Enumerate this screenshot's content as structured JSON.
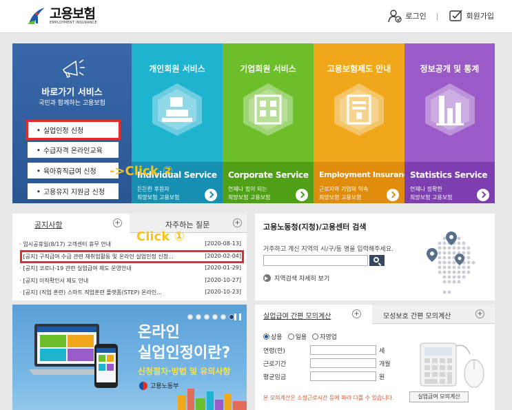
{
  "header": {
    "logo_title": "고용보험",
    "logo_sub": "EMPLOYMENT INSURANCE",
    "login": "로그인",
    "separator": "|",
    "join": "회원가입"
  },
  "shortcut": {
    "title": "바로가기 서비스",
    "subtitle": "국민과 함께하는 고용보험",
    "items": [
      {
        "label": "실업인정 신청"
      },
      {
        "label": "수급자격 온라인교육"
      },
      {
        "label": "육아휴직급여 신청"
      },
      {
        "label": "고용유지 지원금 신청"
      }
    ]
  },
  "annotations": {
    "click2": "->Click ②",
    "click1": "Click ①"
  },
  "panels": [
    {
      "title": "개인회원 서비스",
      "en": "Individual Service",
      "d1": "든든한 후원자",
      "d2": "희망보험 고용보험",
      "color": "#1eb3cf",
      "bottom": "#168fb2"
    },
    {
      "title": "기업회원 서비스",
      "en": "Corporate Service",
      "d1": "언제나 힘이 되는",
      "d2": "희망보험 고용보험",
      "color": "#6cbf2a",
      "bottom": "#4f9f17"
    },
    {
      "title": "고용보험제도 안내",
      "en": "Employment Insurance",
      "d1": "근로자와 기업의 약속",
      "d2": "희망보험 고용보험",
      "color": "#f0a81a",
      "bottom": "#e08d0e"
    },
    {
      "title": "정보공개 및 통계",
      "en": "Statistics Service",
      "d1": "언제나 정확한",
      "d2": "희망보험 고용보험",
      "color": "#9a5ac8",
      "bottom": "#7d3fb0"
    }
  ],
  "notice": {
    "tab_notice": "공지사항",
    "tab_faq": "자주하는 질문",
    "plus": "+",
    "items": [
      {
        "title": "임시공휴일(8/17) 고객센터 휴무 안내",
        "date": "[2020-08-13]"
      },
      {
        "title": "[공지] 구직급여 수급 관련 재취업활동 및 온라인 실업인정 신청...",
        "date": "[2020-02-04]"
      },
      {
        "title": "[공지] 코로나-19 관련 실업급여 제도 운영안내",
        "date": "[2020-01-29]"
      },
      {
        "title": "[공지] 이직확인서 제도 안내",
        "date": "[2020-10-27]"
      },
      {
        "title": "[공지] (직업 훈련) 스마트 직업훈련 플랫폼(STEP) 온라인...",
        "date": "[2020-10-23]"
      }
    ]
  },
  "search": {
    "title": "고용노동청(지청)/고용센터 검색",
    "desc": "거주하고 계신 지역의 시/구/동 명을 입력해주세요.",
    "input_value": "",
    "detail": "지역검색 자세히 보기"
  },
  "banner": {
    "line1": "온라인",
    "line2": "실업인정이란?",
    "line3": "신청절차·방법 및 유의사항",
    "ministry": "고용노동부",
    "active_slide": 6,
    "slide_count": 6
  },
  "calc": {
    "tab1": "실업급여 간편 모의계산",
    "tab2": "모성보호 간편 모의계산",
    "radios": [
      {
        "label": "상용",
        "checked": true
      },
      {
        "label": "일용",
        "checked": false
      },
      {
        "label": "자영업",
        "checked": false
      }
    ],
    "fields": [
      {
        "label": "연령(만)",
        "unit": "세"
      },
      {
        "label": "근로기간",
        "unit": "개월"
      },
      {
        "label": "평균임금",
        "unit": "원"
      }
    ],
    "note": "본 모의계산은 소정근로시간 등에 따라 다를 수 있습니다.",
    "button": "실업급여 모의계산"
  }
}
